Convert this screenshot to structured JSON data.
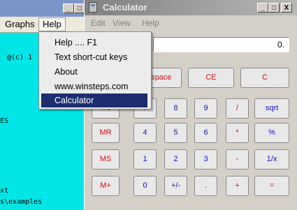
{
  "background_window": {
    "menu": {
      "graphs": "Graphs",
      "help": "Help"
    },
    "content_lines": [
      "@(c) 1",
      "ES",
      "xt",
      "s\\examples"
    ]
  },
  "window_controls": {
    "minimize": "_",
    "maximize": "□",
    "close": "X"
  },
  "help_menu": {
    "items": [
      {
        "label": "Help .... F1",
        "selected": false
      },
      {
        "label": "Text short-cut keys",
        "selected": false
      },
      {
        "label": "About",
        "selected": false
      },
      {
        "label": "www.winsteps.com",
        "selected": false
      },
      {
        "label": "Calculator",
        "selected": true
      }
    ]
  },
  "calculator": {
    "title": "Calculator",
    "menu": [
      "Edit",
      "View",
      "Help"
    ],
    "display": "0.",
    "top_buttons": {
      "backspace": "kspace",
      "ce": "CE",
      "c": "C"
    },
    "memory_buttons": [
      "MC",
      "MR",
      "MS",
      "M+"
    ],
    "keypad": [
      [
        "7",
        "8",
        "9",
        "/",
        "sqrt"
      ],
      [
        "4",
        "5",
        "6",
        "*",
        "%"
      ],
      [
        "1",
        "2",
        "3",
        "-",
        "1/x"
      ],
      [
        "0",
        "+/-",
        ".",
        "+",
        "="
      ]
    ]
  },
  "colors": {
    "content_bg": "#00e6e6",
    "menu_selected": "#1c2e6e",
    "button_blue": "#1010c8",
    "button_red": "#d01010"
  }
}
